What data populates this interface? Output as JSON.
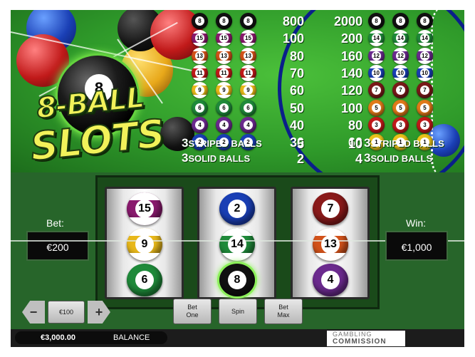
{
  "game": {
    "logo_line1": "8-BALL",
    "logo_line2": "SLOTS",
    "hero_ball_number": "8"
  },
  "paytable": {
    "rows": [
      {
        "type": "solid",
        "ball": "8",
        "color": "#111111",
        "pay3": "800",
        "pay4": "2000"
      },
      {
        "type": "striped",
        "left": "15",
        "right": "14",
        "left_color": "#8a1a6e",
        "right_color": "#1f8a3a",
        "pay3": "100",
        "pay4": "200"
      },
      {
        "type": "striped",
        "left": "13",
        "right": "12",
        "left_color": "#d2521a",
        "right_color": "#6b2a8e",
        "pay3": "80",
        "pay4": "160"
      },
      {
        "type": "striped",
        "left": "11",
        "right": "10",
        "left_color": "#c11a1a",
        "right_color": "#1a3fb5",
        "pay3": "70",
        "pay4": "140"
      },
      {
        "type": "striped",
        "left": "9",
        "right": "7",
        "left_color": "#e8b81a",
        "right_color": "#7a1a1a",
        "right_solid": true,
        "pay3": "60",
        "pay4": "120"
      },
      {
        "type": "solid",
        "left": "6",
        "right": "5",
        "left_color": "#1f8a3a",
        "right_color": "#e07a1a",
        "pay3": "50",
        "pay4": "100"
      },
      {
        "type": "solid",
        "left": "4",
        "right": "3",
        "left_color": "#6b2a8e",
        "right_color": "#c11a1a",
        "pay3": "40",
        "pay4": "80"
      },
      {
        "type": "solid",
        "left": "2",
        "right": "1",
        "left_color": "#1a3fb5",
        "right_color": "#e8c21a",
        "pay3": "30",
        "pay4": "60"
      }
    ],
    "striped_label": "STRIPED BALLS",
    "solid_label": "SOLID BALLS",
    "label_count": "3",
    "striped_pay3": "5",
    "striped_pay4": "10",
    "solid_pay3": "2",
    "solid_pay4": "4"
  },
  "reels": [
    [
      {
        "number": "15",
        "color": "#8a1a6e",
        "striped": true
      },
      {
        "number": "9",
        "color": "#e8b81a",
        "striped": true
      },
      {
        "number": "6",
        "color": "#1f8a3a",
        "striped": false
      }
    ],
    [
      {
        "number": "2",
        "color": "#1a3fb5",
        "striped": false
      },
      {
        "number": "14",
        "color": "#1f8a3a",
        "striped": true
      },
      {
        "number": "8",
        "color": "#111111",
        "striped": false,
        "highlight": true
      }
    ],
    [
      {
        "number": "7",
        "color": "#8a1a1a",
        "striped": false
      },
      {
        "number": "13",
        "color": "#d2521a",
        "striped": true
      },
      {
        "number": "4",
        "color": "#6b2a8e",
        "striped": false
      }
    ]
  ],
  "bet": {
    "label": "Bet:",
    "value": "€200"
  },
  "win": {
    "label": "Win:",
    "value": "€1,000"
  },
  "controls": {
    "decrease": "−",
    "coin_value": "€100",
    "increase": "+",
    "bet_one": "Bet\nOne",
    "spin": "Spin",
    "bet_max": "Bet\nMax"
  },
  "status": {
    "balance_amount": "€3,000.00",
    "balance_label": "BALANCE",
    "logo_line1": "GAMBLING",
    "logo_line2": "COMMISSION"
  }
}
